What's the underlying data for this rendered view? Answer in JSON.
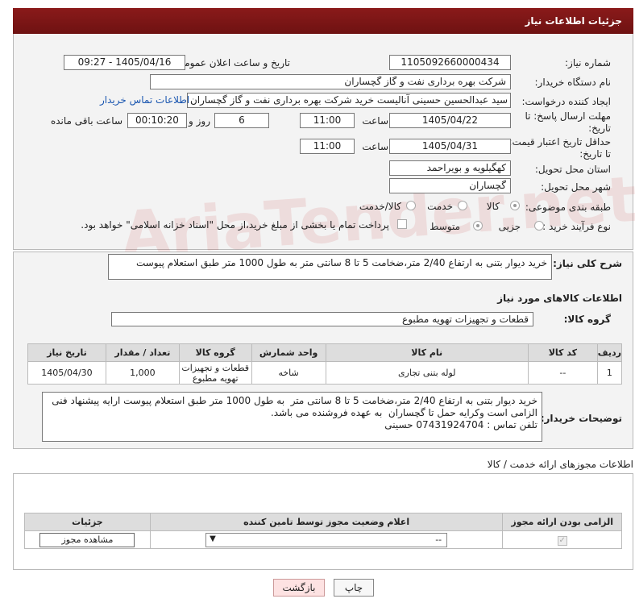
{
  "header": {
    "title": "جزئیات اطلاعات نیاز"
  },
  "form": {
    "need_number_label": "شماره نیاز:",
    "need_number": "1105092660000434",
    "announce_label": "تاریخ و ساعت اعلان عمومی:",
    "announce_value": "1405/04/16 - 09:27",
    "buyer_org_label": "نام دستگاه خریدار:",
    "buyer_org": "شرکت بهره برداری نفت و گاز گچساران",
    "creator_label": "ایجاد کننده درخواست:",
    "creator": "سید عبدالحسین حسینی آنالیست خرید شرکت بهره برداری نفت و گاز گچساران",
    "contact_link": "اطلاعات تماس خریدار",
    "deadline_label": "مهلت ارسال پاسخ: تا تاریخ:",
    "deadline_date": "1405/04/22",
    "time_label": "ساعت",
    "deadline_time": "11:00",
    "days": "6",
    "days_label": "روز و",
    "remaining": "00:10:20",
    "remaining_label": "ساعت باقی مانده",
    "validity_label": "حداقل تاریخ اعتبار قیمت: تا تاریخ:",
    "validity_date": "1405/04/31",
    "validity_time": "11:00",
    "province_label": "استان محل تحویل:",
    "province": "کهگیلویه و بویراحمد",
    "city_label": "شهر محل تحویل:",
    "city": "گچساران",
    "category_label": "طبقه بندی موضوعی:",
    "category_options": [
      "کالا",
      "خدمت",
      "کالا/خدمت"
    ],
    "category_selected": "کالا",
    "process_label": "نوع فرآیند خرید :",
    "process_options": [
      "جزیی",
      "متوسط"
    ],
    "process_selected": "متوسط",
    "payment_note": "پرداخت تمام یا بخشی از مبلغ خرید،از محل \"اسناد خزانه اسلامی\" خواهد بود."
  },
  "summary": {
    "label": "شرح کلی نیاز:",
    "text": "خرید دیوار بتنی به ارتفاع 2/40 متر،ضخامت 5 تا 8 سانتی متر  به طول 1000 متر طبق استعلام پیوست"
  },
  "goods": {
    "section_title": "اطلاعات کالاهای مورد نیاز",
    "group_label": "گروه کالا:",
    "group_value": "قطعات و تجهیزات تهویه مطبوع",
    "columns": [
      "ردیف",
      "کد کالا",
      "نام کالا",
      "واحد شمارش",
      "گروه کالا",
      "تعداد / مقدار",
      "تاریخ نیاز"
    ],
    "rows": [
      {
        "row": "1",
        "code": "--",
        "name": "لوله بتنی تجاری",
        "unit": "شاخه",
        "group": "قطعات و تجهیزات تهویه مطبوع",
        "qty": "1,000",
        "date": "1405/04/30"
      }
    ]
  },
  "buyer_notes": {
    "label": "توضیحات خریدار:",
    "text": "خرید دیوار بتنی به ارتفاع 2/40 متر،ضخامت 5 تا 8 سانتی متر  به طول 1000 متر طبق استعلام پیوست ارایه پیشنهاد فنی الزامی است وکرایه حمل تا گچساران  به عهده فروشنده می باشد.\nتلفن تماس : 07431924704 حسینی"
  },
  "licenses": {
    "section_title": "اطلاعات مجوزهای ارائه خدمت / کالا",
    "columns": [
      "الزامی بودن ارائه مجوز",
      "اعلام وضعیت مجوز توسط تامین کننده",
      "جزئیات"
    ],
    "select_value": "--",
    "view_button": "مشاهده مجوز"
  },
  "buttons": {
    "print": "چاپ",
    "back": "بازگشت"
  },
  "watermark": "AriaTender.net"
}
